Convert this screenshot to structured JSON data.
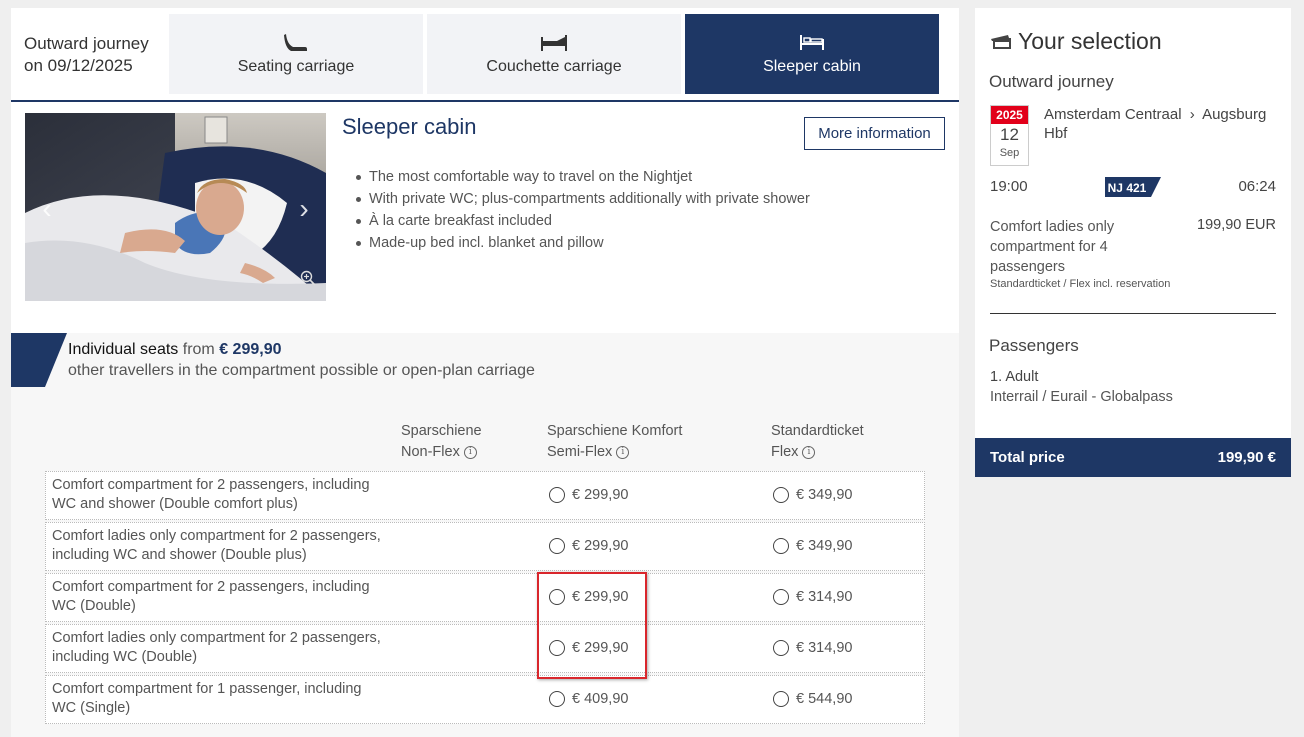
{
  "journey": {
    "label_line1": "Outward journey",
    "label_line2": "on 09/12/2025"
  },
  "tabs": [
    {
      "label": "Seating carriage",
      "icon": "seat-icon",
      "active": false
    },
    {
      "label": "Couchette carriage",
      "icon": "couchette-icon",
      "active": false
    },
    {
      "label": "Sleeper cabin",
      "icon": "bed-icon",
      "active": true
    }
  ],
  "cabin": {
    "title": "Sleeper cabin",
    "more_info": "More information",
    "features": [
      "The most comfortable way to travel on the Nightjet",
      "With private WC; plus-compartments additionally with private shower",
      "À la carte breakfast included",
      "Made-up bed incl. blanket and pillow"
    ]
  },
  "seats": {
    "heading_strong": "Individual seats",
    "heading_from": "from",
    "heading_price": "€ 299,90",
    "subtitle": "other travellers in the compartment possible or open-plan carriage",
    "columns": [
      {
        "line1": "Sparschiene",
        "line2": "Non-Flex"
      },
      {
        "line1": "Sparschiene Komfort",
        "line2": "Semi-Flex"
      },
      {
        "line1": "Standardticket",
        "line2": "Flex"
      }
    ],
    "rows": [
      {
        "line1": "Comfort compartment for 2 passengers, including",
        "line2": "WC and shower (Double comfort plus)",
        "semi": "€ 299,90",
        "flex": "€ 349,90"
      },
      {
        "line1": "Comfort ladies only compartment for 2 passengers,",
        "line2": "including WC and shower (Double plus)",
        "semi": "€ 299,90",
        "flex": "€ 349,90"
      },
      {
        "line1": "Comfort compartment for 2 passengers, including",
        "line2": "WC (Double)",
        "semi": "€ 299,90",
        "flex": "€ 314,90"
      },
      {
        "line1": "Comfort ladies only compartment for 2 passengers,",
        "line2": "including WC (Double)",
        "semi": "€ 299,90",
        "flex": "€ 314,90"
      },
      {
        "line1": "Comfort compartment for 1 passenger, including",
        "line2": "WC (Single)",
        "semi": "€ 409,90",
        "flex": "€ 544,90"
      }
    ]
  },
  "selection": {
    "title": "Your selection",
    "journey_label": "Outward journey",
    "date": {
      "year": "2025",
      "day": "12",
      "month": "Sep"
    },
    "from": "Amsterdam Centraal",
    "to": "Augsburg Hbf",
    "departure": "19:00",
    "train": "NJ 421",
    "arrival": "06:24",
    "fare_line1": "Comfort ladies only",
    "fare_line2": "compartment for 4",
    "fare_line3": "passengers",
    "fare_price": "199,90 EUR",
    "fare_type": "Standardticket / Flex incl. reservation",
    "passengers_title": "Passengers",
    "passenger_1": "1. Adult",
    "passenger_1_pass": "Interrail / Eurail - Globalpass",
    "total_label": "Total price",
    "total_value": "199,90 €"
  },
  "colors": {
    "brand_navy": "#1e3765",
    "date_red": "#e2001a",
    "highlight_red": "#d9262c"
  }
}
